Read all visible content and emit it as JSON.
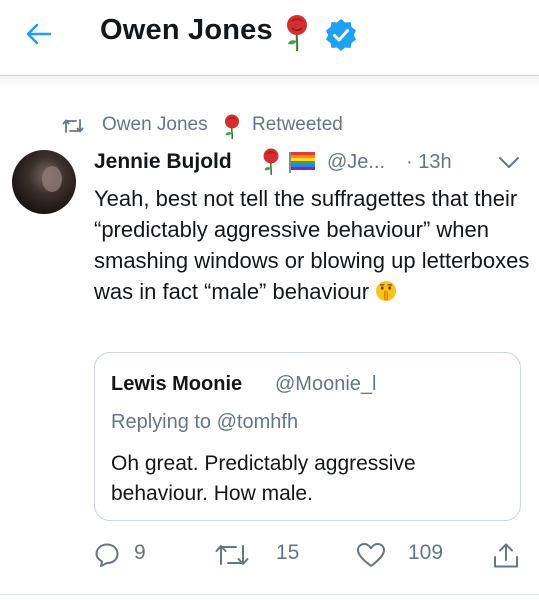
{
  "header": {
    "title": "Owen Jones",
    "accent_color": "#1da1f2",
    "icons": [
      "back-arrow-icon",
      "rose-icon",
      "verified-badge-icon"
    ]
  },
  "retweet": {
    "name": "Owen Jones",
    "label": "Retweeted"
  },
  "tweet": {
    "author_name": "Jennie Bujold",
    "handle": "@Je...",
    "time": "· 13h",
    "text": "Yeah, best not tell the suffragettes that their “predictably aggressive behaviour” when smashing windows or blowing up letterboxes was in fact “male” behaviour"
  },
  "quote": {
    "author_name": "Lewis Moonie",
    "handle": "@Moonie_l",
    "replying_to": "Replying to @tomhfh",
    "text": "Oh great. Predictably aggressive behaviour. How male."
  },
  "actions": {
    "replies": "9",
    "retweets": "15",
    "likes": "109"
  }
}
